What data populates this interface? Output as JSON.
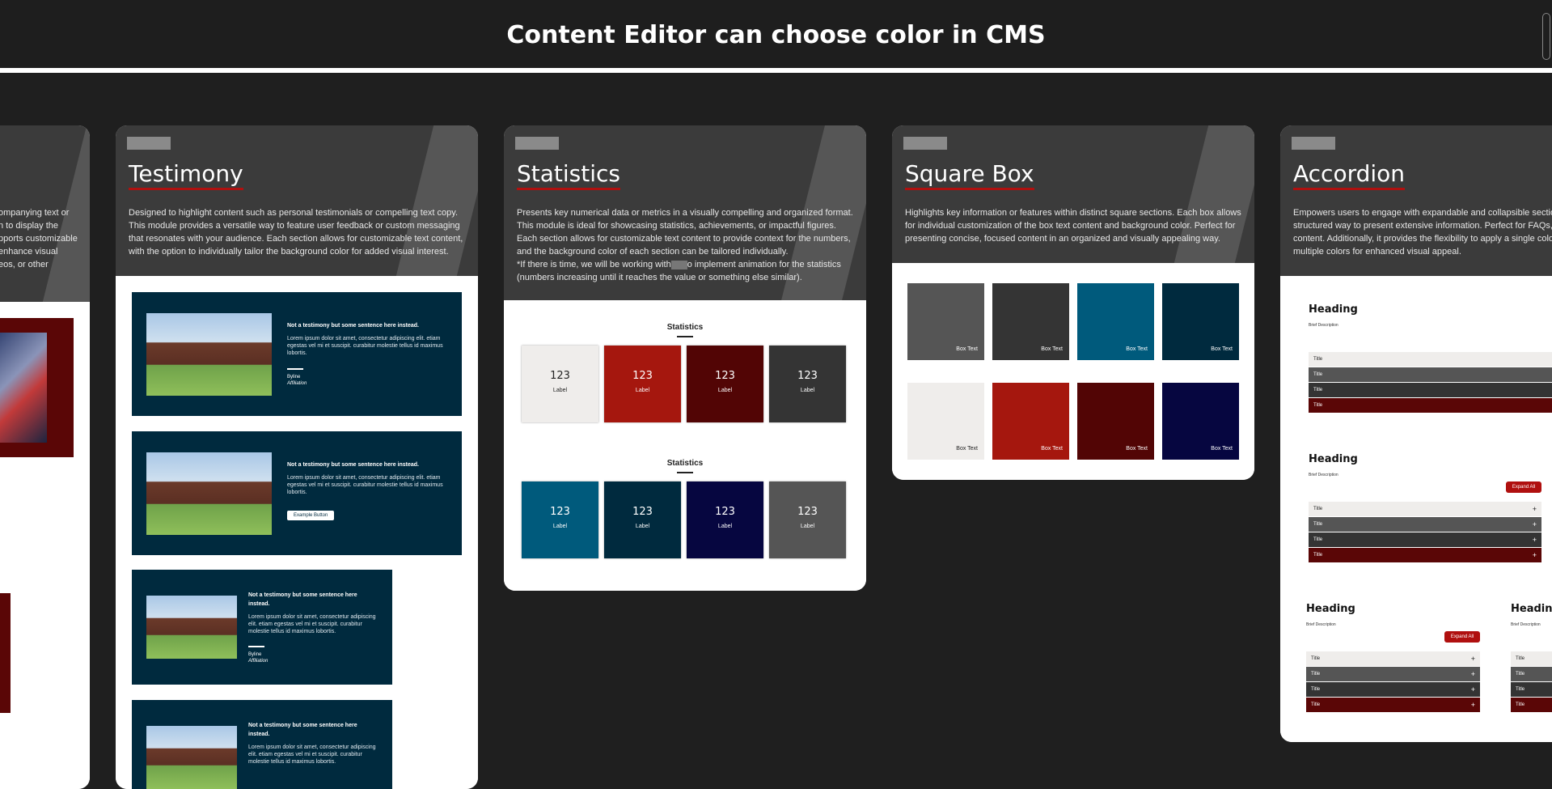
{
  "page_title": "Content Editor can choose color in CMS",
  "colors": {
    "background": "#1f1f1f",
    "card_header": "#3b3b3b",
    "accent_red": "#b0100f",
    "navy": "#002a3e"
  },
  "left_card": {
    "desc_lines": [
      "ompanying text or",
      "n to display the",
      "pports customizable",
      "enhance visual",
      "eos, or other"
    ]
  },
  "testimony": {
    "title": "Testimony",
    "description": "Designed to highlight content such as personal testimonials or compelling text copy. This module provides a versatile way to feature user feedback or custom messaging that resonates with your audience. Each section allows for customizable text content, with the option to individually tailor the background color for added visual interest.",
    "item_title": "Not a testimony but some sentence here instead.",
    "item_body": "Lorem ipsum dolor sit amet, consectetur adipiscing elit. etiam egestas vel mi et suscipit. curabitur molestie tellus id maximus lobortis.",
    "byline": "Byline",
    "affiliation": "Affiliation",
    "button_label": "Example Button"
  },
  "statistics": {
    "title": "Statistics",
    "description": "Presents key numerical data or metrics in a visually compelling and organized format. This module is ideal for showcasing statistics, achievements, or impactful figures. Each section allows for customizable text content to provide context for the numbers, and the background color of each section can be tailored individually.",
    "note_before": "*If there is time, we will be working with",
    "note_after": "o implement animation for the statistics (numbers increasing until it reaches the value or something else similar).",
    "section_heading": "Statistics",
    "stat_number": "123",
    "stat_label": "Label",
    "row1_colors": [
      "#efedeb",
      "#a5170e",
      "#520505",
      "#343434"
    ],
    "row2_colors": [
      "#005a7c",
      "#002a3e",
      "#060640",
      "#555555"
    ]
  },
  "square_box": {
    "title": "Square Box",
    "description": "Highlights key information or features within distinct square sections. Each box allows for individual customization of the box text content and background color. Perfect for presenting concise, focused content in an organized and visually appealing way.",
    "box_text": "Box Text",
    "row1_colors": [
      "#555555",
      "#343434",
      "#005a7c",
      "#002a3e"
    ],
    "row2_colors": [
      "#efedeb",
      "#a5170e",
      "#520505",
      "#060640"
    ]
  },
  "accordion": {
    "title": "Accordion",
    "description": "Empowers users to engage with expandable and collapsible sections, structured way to present extensive information. Perfect for FAQs, st content. Additionally, it provides the flexibility to apply a single color multiple colors for enhanced visual appeal.",
    "heading": "Heading",
    "brief": "Brief Description",
    "expand_all": "Expand All",
    "row_title": "Title",
    "row_colors": [
      "#efedeb",
      "#555555",
      "#343434",
      "#5a0606"
    ]
  }
}
